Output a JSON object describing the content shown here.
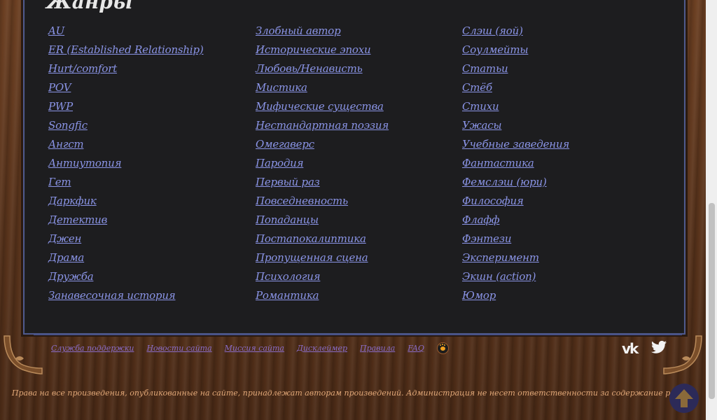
{
  "heading": "Жанры",
  "genres": {
    "col1": [
      "AU",
      "ER (Established Relationship)",
      "Hurt/comfort",
      "POV",
      "PWP",
      "Songfic",
      "Ангст",
      "Антиутопия",
      "Гет",
      "Даркфик",
      "Детектив",
      "Джен",
      "Драма",
      "Дружба",
      "Занавесочная история"
    ],
    "col2": [
      "Злобный автор",
      "Исторические эпохи",
      "Любовь/Ненависть",
      "Мистика",
      "Мифические существа",
      "Нестандартная поэзия",
      "Омегаверс",
      "Пародия",
      "Первый раз",
      "Повседневность",
      "Попаданцы",
      "Постапокалиптика",
      "Пропущенная сцена",
      "Психология",
      "Романтика"
    ],
    "col3": [
      "Слэш (яой)",
      "Соулмейты",
      "Статьи",
      "Стёб",
      "Стихи",
      "Ужасы",
      "Учебные заведения",
      "Фантастика",
      "Фемслэш (юри)",
      "Философия",
      "Флафф",
      "Фэнтези",
      "Эксперимент",
      "Экшн (action)",
      "Юмор"
    ]
  },
  "footer": {
    "links": [
      "Служба поддержки",
      "Новости сайта",
      "Миссия сайта",
      "Дисклеймер",
      "Правила",
      "FAQ"
    ]
  },
  "social": {
    "vk_label": "vk"
  },
  "copyright": "Права на все произведения, опубликованные на сайте, принадлежат авторам произведений. Администрация не несет ответственности за содержание работ.",
  "icons": {
    "paw": "paw-icon",
    "vk": "vk-icon",
    "twitter": "twitter-icon",
    "up": "arrow-up-icon"
  },
  "colors": {
    "link": "#8a94e6",
    "panel": "#1d1d1f",
    "footer_text": "#e2a878"
  }
}
